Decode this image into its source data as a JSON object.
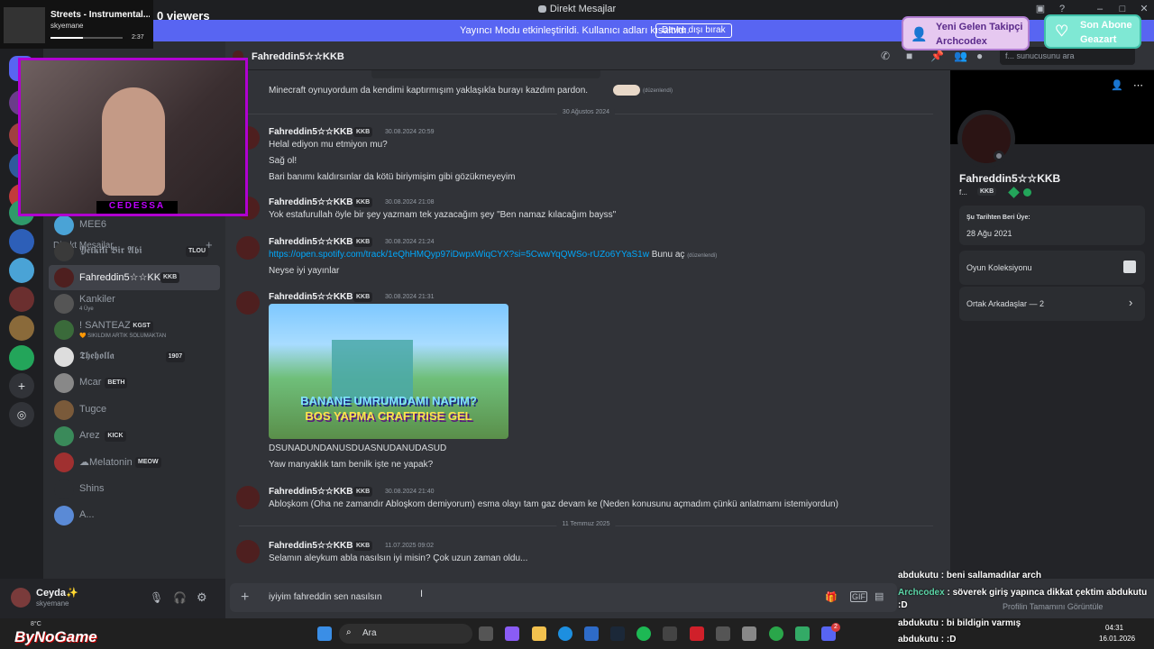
{
  "window": {
    "title": "Direkt Mesajlar"
  },
  "banner": {
    "text": "Yayıncı Modu etkinleştirildi. Kullanıcı adları kısaltıldı.",
    "button": "Devre dışı bırak"
  },
  "stream": {
    "viewers": "0 viewers",
    "track": "Streets - Instrumental...",
    "artist": "skyemane",
    "elapsed": "2:37",
    "progress": 0.45,
    "webcam_label": "CEDESSA"
  },
  "alerts": {
    "follower_title": "Yeni Gelen Takipçi",
    "follower_name": "Archcodex",
    "sub_title": "Son Abone",
    "sub_name": "Geazart"
  },
  "sidebar": {
    "header": "Direkt Mesajlar",
    "search_hint": "Sohbet bul ya da başlat",
    "dms": [
      {
        "name": "MEE6",
        "tag": "",
        "sub": ""
      },
      {
        "name": "𝖄𝖊𝖙𝖐𝖎𝖑𝖎 𝕭𝖎𝖗 𝕬𝖇𝖎",
        "tag": "TLOU",
        "sub": ""
      },
      {
        "name": "Fahreddin5☆☆KKB",
        "tag": "KKB",
        "sub": ""
      },
      {
        "name": "Kankiler",
        "tag": "",
        "sub": "4 Üye"
      },
      {
        "name": "! SANTEAZ",
        "tag": "KGST",
        "sub": "🧡 SIKILDIM ARTIK SOLUMAKTAN"
      },
      {
        "name": "𝕿𝖍𝖊𝖍𝖔𝖑𝖑𝖆",
        "tag": "1907",
        "sub": ""
      },
      {
        "name": "Mcar",
        "tag": "BETH",
        "sub": ""
      },
      {
        "name": "Tugce",
        "tag": "",
        "sub": ""
      },
      {
        "name": "Arez",
        "tag": "KICK",
        "sub": ""
      },
      {
        "name": "☁Melatonin",
        "tag": "MEOW",
        "sub": ""
      },
      {
        "name": "Shins",
        "tag": "",
        "sub": ""
      },
      {
        "name": "A...",
        "tag": "",
        "sub": ""
      }
    ]
  },
  "user": {
    "name": "Ceyda✨",
    "status": "skyemane"
  },
  "chat": {
    "title": "Fahreddin5☆☆KKB",
    "search_placeholder": "f... sunucusunu ara",
    "first_line": "Minecraft oynuyordum da kendimi kaptırmışım yaklaşıkla burayı kazdım pardon.",
    "edited": "(düzenlendi)",
    "date1": "30 Ağustos 2024",
    "date2": "11 Temmuz 2025",
    "groups": [
      {
        "author": "Fahreddin5☆☆KKB",
        "badge": "KKB",
        "ts": "30.08.2024 20:59",
        "lines": [
          "Helal ediyon mu etmiyon mu?",
          "Sağ ol!",
          "Bari banımı kaldırsınlar da kötü biriymişim gibi gözükmeyeyim"
        ]
      },
      {
        "author": "Fahreddin5☆☆KKB",
        "badge": "KKB",
        "ts": "30.08.2024 21:08",
        "lines": [
          "Yok estafurullah öyle bir şey yazmam tek yazacağım şey \"Ben namaz kılacağım bayss\""
        ]
      },
      {
        "author": "Fahreddin5☆☆KKB",
        "badge": "KKB",
        "ts": "30.08.2024 21:24",
        "link": "https://open.spotify.com/track/1eQhHMQyp97iDwpxWiqCYX?si=5CwwYqQWSo-rUZo6YYaS1w",
        "link_after": "Bunu aç",
        "lines": [
          "Neyse iyi yayınlar"
        ]
      },
      {
        "author": "Fahreddin5☆☆KKB",
        "badge": "KKB",
        "ts": "30.08.2024 21:31",
        "image_text1": "BANANE UMRUMDAMI NAPIM?",
        "image_text2": "BOS YAPMA CRAFTRISE GEL",
        "lines": [
          "DSUNADUNDANUSDUASNUDANUDASUD",
          "Yaw manyaklık tam benilk işte ne yapak?"
        ]
      },
      {
        "author": "Fahreddin5☆☆KKB",
        "badge": "KKB",
        "ts": "30.08.2024 21:40",
        "lines": [
          "Abloşkom (Oha ne zamandır Abloşkom demiyorum) esma olayı tam gaz devam ke (Neden konusunu açmadım çünkü anlatmamı istemiyordun)"
        ]
      },
      {
        "author": "Fahreddin5☆☆KKB",
        "badge": "KKB",
        "ts": "11.07.2025 09:02",
        "lines": [
          "Selamın aleykum abla nasılsın iyi misin? Çok uzun zaman oldu..."
        ]
      }
    ],
    "composer_text": "iyiyim fahreddin sen nasılsın"
  },
  "profile": {
    "name": "Fahreddin5☆☆KKB",
    "handle": "f...",
    "badge": "KKB",
    "member_since_label": "Şu Tarihten Beri Üye:",
    "member_since": "28 Ağu 2021",
    "games": "Oyun Koleksiyonu",
    "mutual": "Ortak Arkadaşlar — 2",
    "full_profile": "Profilin Tamamını Görüntüle"
  },
  "overlay_chat": [
    {
      "user": "abdukutu",
      "text": ": beni sallamadılar arch",
      "color": "#ffffff"
    },
    {
      "user": "Archcodex",
      "text": ": söverek giriş yapınca dikkat çektim abdukutu :D",
      "color": "#5cd6a8"
    },
    {
      "user": "abdukutu",
      "text": ": bi bildigin varmış",
      "color": "#ffffff"
    },
    {
      "user": "abdukutu",
      "text": ": :D",
      "color": "#ffffff"
    }
  ],
  "taskbar": {
    "search": "Ara",
    "time": "04:31",
    "date": "16.01.2026",
    "weather": "8°C",
    "brand": "ByNoGame",
    "notif": "2"
  },
  "colors": {
    "accent": "#5865f2",
    "purple": "#b000d0",
    "link": "#00a8fc"
  }
}
